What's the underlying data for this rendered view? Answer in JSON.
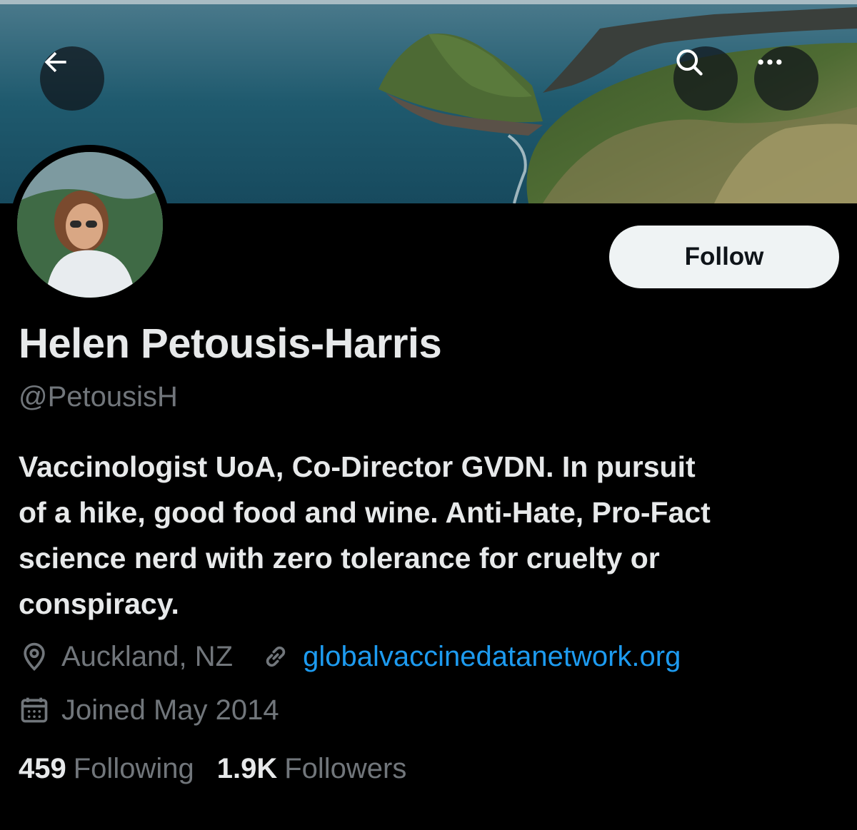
{
  "header": {
    "back_icon": "arrow-left-icon",
    "search_icon": "search-icon",
    "more_icon": "more-horizontal-icon"
  },
  "profile": {
    "display_name": "Helen Petousis-Harris",
    "handle": "@PetousisH",
    "follow_label": "Follow",
    "bio_lines": [
      "Vaccinologist UoA, Co-Director GVDN. In pursuit",
      "of a hike, good food and wine. Anti-Hate, Pro-Fact",
      "science nerd with zero tolerance for cruelty or",
      "conspiracy."
    ],
    "location": "Auckland, NZ",
    "website": "globalvaccinedatanetwork.org",
    "joined": "Joined May 2014",
    "following_count": "459",
    "following_label": "Following",
    "followers_count": "1.9K",
    "followers_label": "Followers"
  },
  "colors": {
    "background": "#000000",
    "text_primary": "#e7e9ea",
    "text_secondary": "#71767b",
    "link": "#1d9bf0",
    "follow_button_bg": "#eff3f4"
  }
}
